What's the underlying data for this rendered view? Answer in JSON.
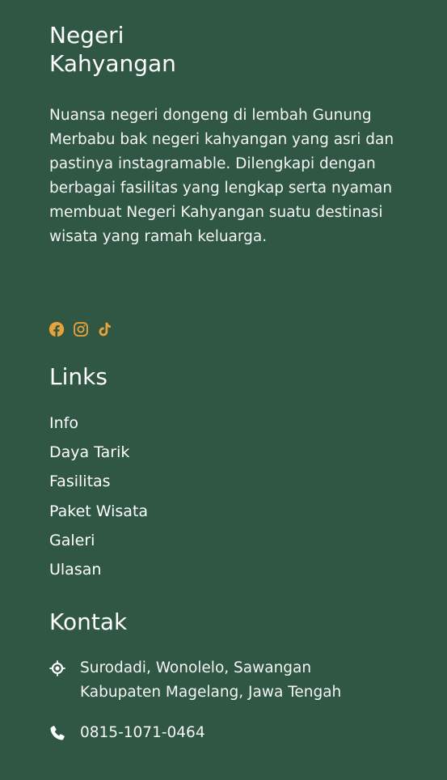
{
  "brand": {
    "title_line1": "Negeri",
    "title_line2": "Kahyangan",
    "description": "Nuansa negeri dongeng di lembah Gunung Merbabu bak negeri kahyangan yang asri dan pastinya instagramable. Dilengkapi dengan berbagai fasilitas yang lengkap serta nyaman membuat Negeri Kahyangan suatu destinasi wisata yang ramah keluarga."
  },
  "social": {
    "accent_color": "#e9a23b",
    "icons": [
      "facebook-icon",
      "instagram-icon",
      "tiktok-icon"
    ]
  },
  "links": {
    "title": "Links",
    "items": [
      "Info",
      "Daya Tarik",
      "Fasilitas",
      "Paket Wisata",
      "Galeri",
      "Ulasan"
    ]
  },
  "contact": {
    "title": "Kontak",
    "address_line1": "Surodadi, Wonolelo, Sawangan",
    "address_line2": "Kabupaten Magelang, Jawa Tengah",
    "phone": "0815-1071-0464",
    "icons": [
      "location-icon",
      "phone-icon"
    ]
  },
  "colors": {
    "background": "#2f5743",
    "text": "#ffffff",
    "accent": "#e9a23b"
  }
}
